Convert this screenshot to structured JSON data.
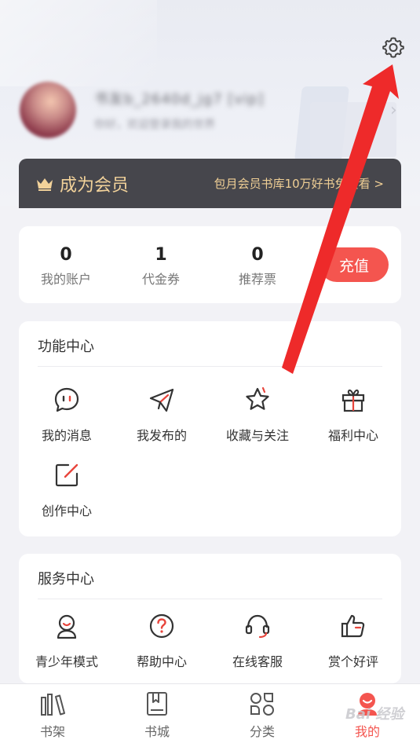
{
  "profile": {
    "username": "书友b_2640d_jg7 [vip]",
    "subtitle": "你好，欢迎登录我的世界"
  },
  "vip": {
    "title": "成为会员",
    "desc": "包月会员书库10万好书免费看 >"
  },
  "account": {
    "stats": [
      {
        "value": "0",
        "label": "我的账户"
      },
      {
        "value": "1",
        "label": "代金券"
      },
      {
        "value": "0",
        "label": "推荐票"
      }
    ],
    "recharge_label": "充值"
  },
  "functions": {
    "title": "功能中心",
    "items": [
      {
        "label": "我的消息",
        "icon": "message-icon"
      },
      {
        "label": "我发布的",
        "icon": "paper-plane-icon"
      },
      {
        "label": "收藏与关注",
        "icon": "star-icon"
      },
      {
        "label": "福利中心",
        "icon": "gift-icon"
      },
      {
        "label": "创作中心",
        "icon": "edit-icon"
      }
    ]
  },
  "services": {
    "title": "服务中心",
    "items": [
      {
        "label": "青少年模式",
        "icon": "teen-mode-icon"
      },
      {
        "label": "帮助中心",
        "icon": "help-icon"
      },
      {
        "label": "在线客服",
        "icon": "headset-icon"
      },
      {
        "label": "赏个好评",
        "icon": "thumbs-up-icon"
      }
    ]
  },
  "tabbar": {
    "items": [
      {
        "label": "书架",
        "icon": "bookshelf-icon"
      },
      {
        "label": "书城",
        "icon": "bookstore-icon"
      },
      {
        "label": "分类",
        "icon": "category-icon"
      },
      {
        "label": "我的",
        "icon": "profile-icon"
      }
    ],
    "active_index": 3
  },
  "watermark": "Bai 经验",
  "colors": {
    "accent": "#f4554f",
    "vip_bg": "#46464c",
    "vip_text": "#f2d29a",
    "annotation_arrow": "#ee2a2a"
  }
}
